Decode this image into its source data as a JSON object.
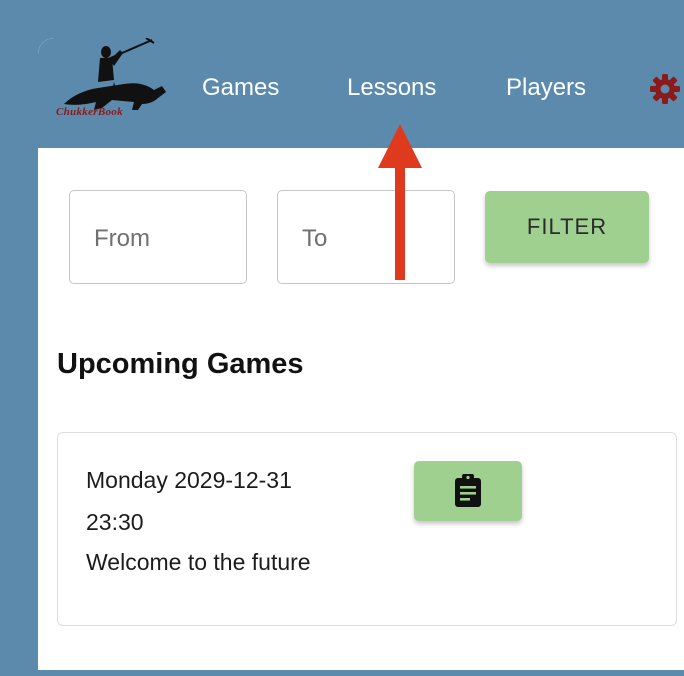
{
  "app": {
    "logo_text": "ChukkerBook"
  },
  "nav": {
    "games": "Games",
    "lessons": "Lessons",
    "players": "Players",
    "settings_icon": "gear-icon"
  },
  "filter": {
    "from_placeholder": "From",
    "to_placeholder": "To",
    "button_label": "FILTER"
  },
  "section": {
    "title": "Upcoming Games"
  },
  "games": [
    {
      "date": "Monday 2029-12-31",
      "time": "23:30",
      "title": "Welcome to the future",
      "action_icon": "clipboard-icon"
    }
  ],
  "annotation": {
    "arrow_icon": "red-arrow-up-icon",
    "color": "#e03a1e"
  },
  "colors": {
    "background": "#5b8aad",
    "accent_green": "#9fd08f",
    "brand_red": "#8b1a1a"
  }
}
